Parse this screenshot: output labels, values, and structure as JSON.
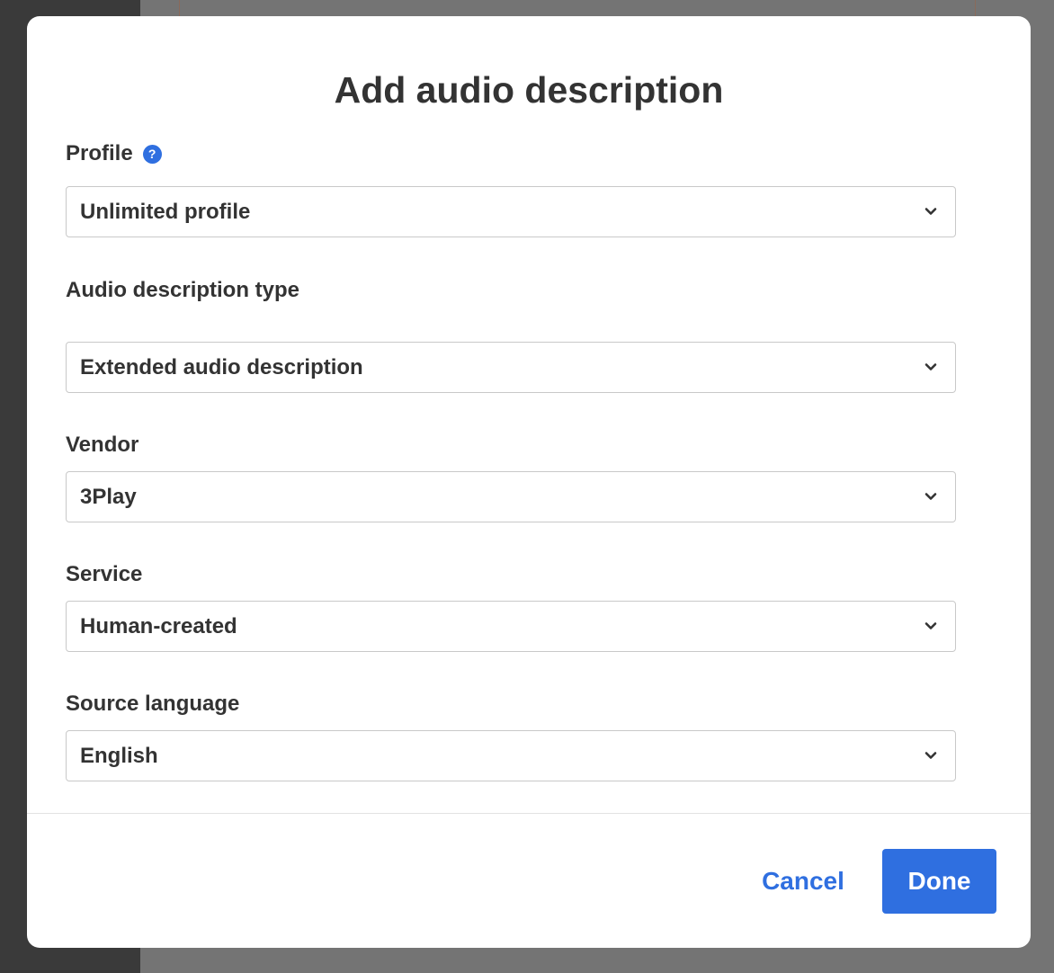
{
  "dialog": {
    "title": "Add audio description"
  },
  "fields": {
    "profile": {
      "label": "Profile",
      "value": "Unlimited profile",
      "help_icon": "question-icon"
    },
    "ad_type": {
      "label": "Audio description type",
      "value": "Extended audio description"
    },
    "vendor": {
      "label": "Vendor",
      "value": "3Play"
    },
    "service": {
      "label": "Service",
      "value": "Human-created"
    },
    "source_language": {
      "label": "Source language",
      "value": "English"
    }
  },
  "footer": {
    "cancel_label": "Cancel",
    "done_label": "Done"
  },
  "colors": {
    "accent": "#2f6fe0",
    "text": "#333333",
    "border": "#c9c9c9",
    "backdrop": "#747474"
  }
}
